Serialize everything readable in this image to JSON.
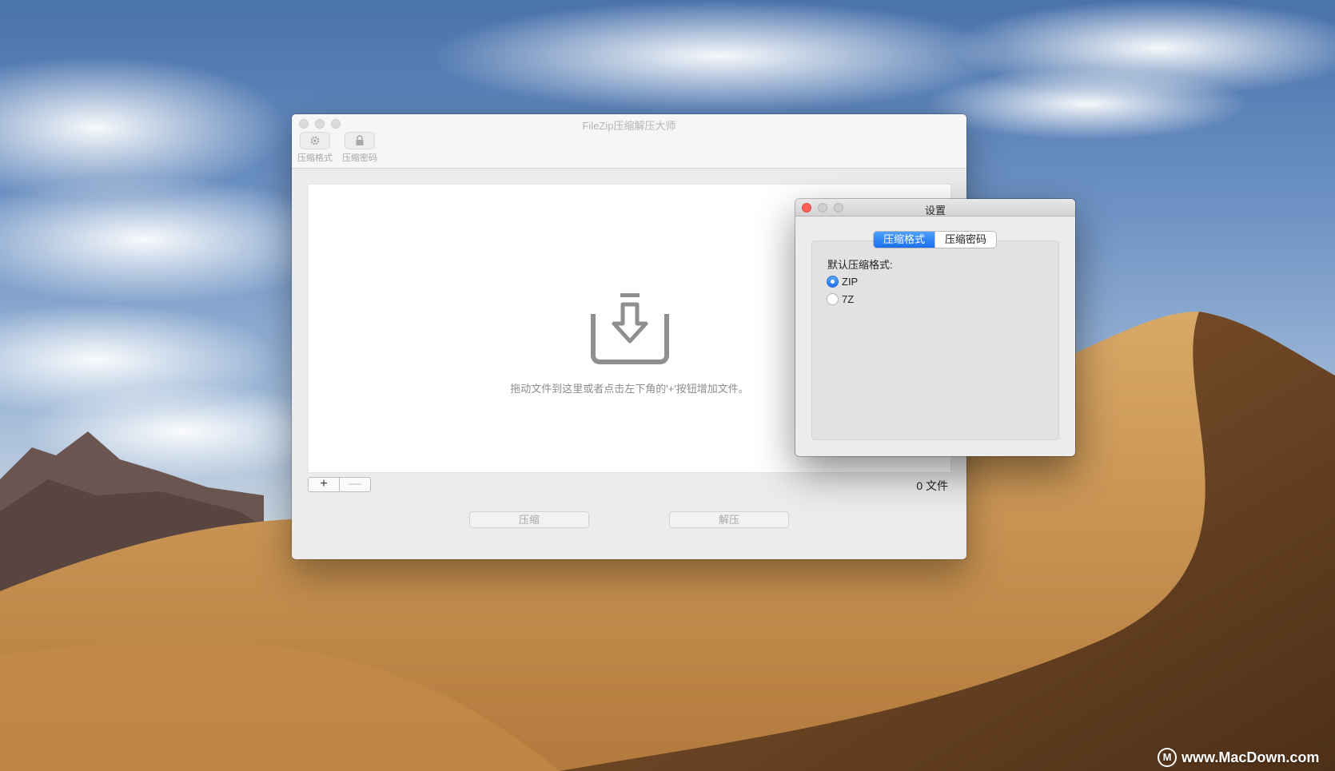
{
  "main_window": {
    "title": "FileZip压缩解压大师",
    "toolbar": {
      "items": [
        {
          "label": "压缩格式",
          "icon": "gear-icon"
        },
        {
          "label": "压缩密码",
          "icon": "lock-icon"
        }
      ]
    },
    "drop_area": {
      "hint": "拖动文件到这里或者点击左下角的'+'按钮增加文件。",
      "icon": "download-tray-icon"
    },
    "bottom_bar": {
      "add_label": "+",
      "remove_label": "—",
      "file_count": "0 文件"
    },
    "actions": {
      "compress_label": "压缩",
      "extract_label": "解压"
    }
  },
  "settings_window": {
    "title": "设置",
    "tabs": [
      {
        "label": "压缩格式",
        "active": true
      },
      {
        "label": "压缩密码",
        "active": false
      }
    ],
    "format_label": "默认压缩格式:",
    "options": [
      {
        "label": "ZIP",
        "checked": true
      },
      {
        "label": "7Z",
        "checked": false
      }
    ]
  },
  "watermark": {
    "logo": "M",
    "text": "www.MacDown.com"
  },
  "colors": {
    "accent": "#1c6ff1",
    "close_button": "#fc5f57"
  }
}
